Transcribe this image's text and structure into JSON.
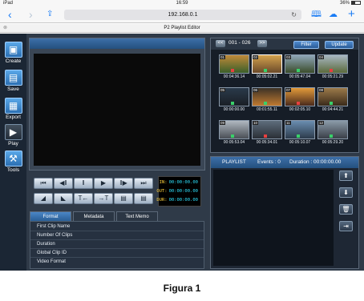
{
  "status": {
    "device": "iPad",
    "time": "16:59",
    "battery": "36%"
  },
  "safari": {
    "url": "192.168.0.1",
    "back_icon": "chevron-left-icon",
    "forward_icon": "chevron-right-icon",
    "share_icon": "share-icon",
    "reload_icon": "reload-icon",
    "bookmarks_icon": "book-icon",
    "tabs_icon": "cloud-icon",
    "new_tab_icon": "plus-icon"
  },
  "tab": {
    "title": "P2 Playlist Editor"
  },
  "toolbar": {
    "items": [
      {
        "label": "Create",
        "icon": "create-icon"
      },
      {
        "label": "Save",
        "icon": "save-icon"
      },
      {
        "label": "Export",
        "icon": "export-icon"
      },
      {
        "label": "Play",
        "icon": "play-icon"
      },
      {
        "label": "Tools",
        "icon": "tools-icon"
      }
    ]
  },
  "timecode": {
    "in_label": "IN:",
    "in": "00:00:00.00",
    "out_label": "OUT:",
    "out": "00:00:00.00",
    "dur_label": "DUR:",
    "dur": "00:00:00.00"
  },
  "tabs": [
    {
      "label": "Format"
    },
    {
      "label": "Metadata"
    },
    {
      "label": "Text Memo"
    }
  ],
  "properties": [
    {
      "label": "First Clip Name"
    },
    {
      "label": "Number Of Clips"
    },
    {
      "label": "Duration"
    },
    {
      "label": "Global Clip ID"
    },
    {
      "label": "Video Format"
    }
  ],
  "thumbs": {
    "range": "001 - 026",
    "filter_label": "Filter",
    "update_label": "Update",
    "clips": [
      {
        "num": "01",
        "tc": "00:04:36.14",
        "colors": [
          "#c08a3a",
          "#3b5f2a"
        ]
      },
      {
        "num": "02",
        "tc": "00:05:02.21",
        "colors": [
          "#d4a24e",
          "#6b4a2a"
        ]
      },
      {
        "num": "03",
        "tc": "00:05:47.04",
        "colors": [
          "#8fa6b8",
          "#3a4c2a"
        ]
      },
      {
        "num": "04",
        "tc": "00:05:21.29",
        "colors": [
          "#a8b7c2",
          "#5b6a3c"
        ]
      },
      {
        "num": "05",
        "tc": "00:00:00.00",
        "colors": [
          "#2a3a4a",
          "#1a1f26"
        ]
      },
      {
        "num": "06",
        "tc": "00:01:55.11",
        "colors": [
          "#3c3226",
          "#c07a30"
        ]
      },
      {
        "num": "07",
        "tc": "00:02:05.10",
        "colors": [
          "#e29a3a",
          "#4a2a1c"
        ]
      },
      {
        "num": "08",
        "tc": "00:04:44.21",
        "colors": [
          "#9c7a4a",
          "#3a2a1a"
        ]
      },
      {
        "num": "09",
        "tc": "00:05:53.04",
        "colors": [
          "#b0b8c0",
          "#4a4f56"
        ]
      },
      {
        "num": "10",
        "tc": "00:05:34.01",
        "colors": [
          "#5e6d7c",
          "#2a2f36"
        ]
      },
      {
        "num": "11",
        "tc": "00:05:10.07",
        "colors": [
          "#6a8db0",
          "#2c3b4c"
        ]
      },
      {
        "num": "12",
        "tc": "00:05:29.20",
        "colors": [
          "#8a9aa8",
          "#3a3f48"
        ]
      }
    ]
  },
  "playlist": {
    "title": "PLAYLIST",
    "events": "Events : 0",
    "duration": "Duration :  00:00:00.00"
  },
  "caption": "Figura 1"
}
